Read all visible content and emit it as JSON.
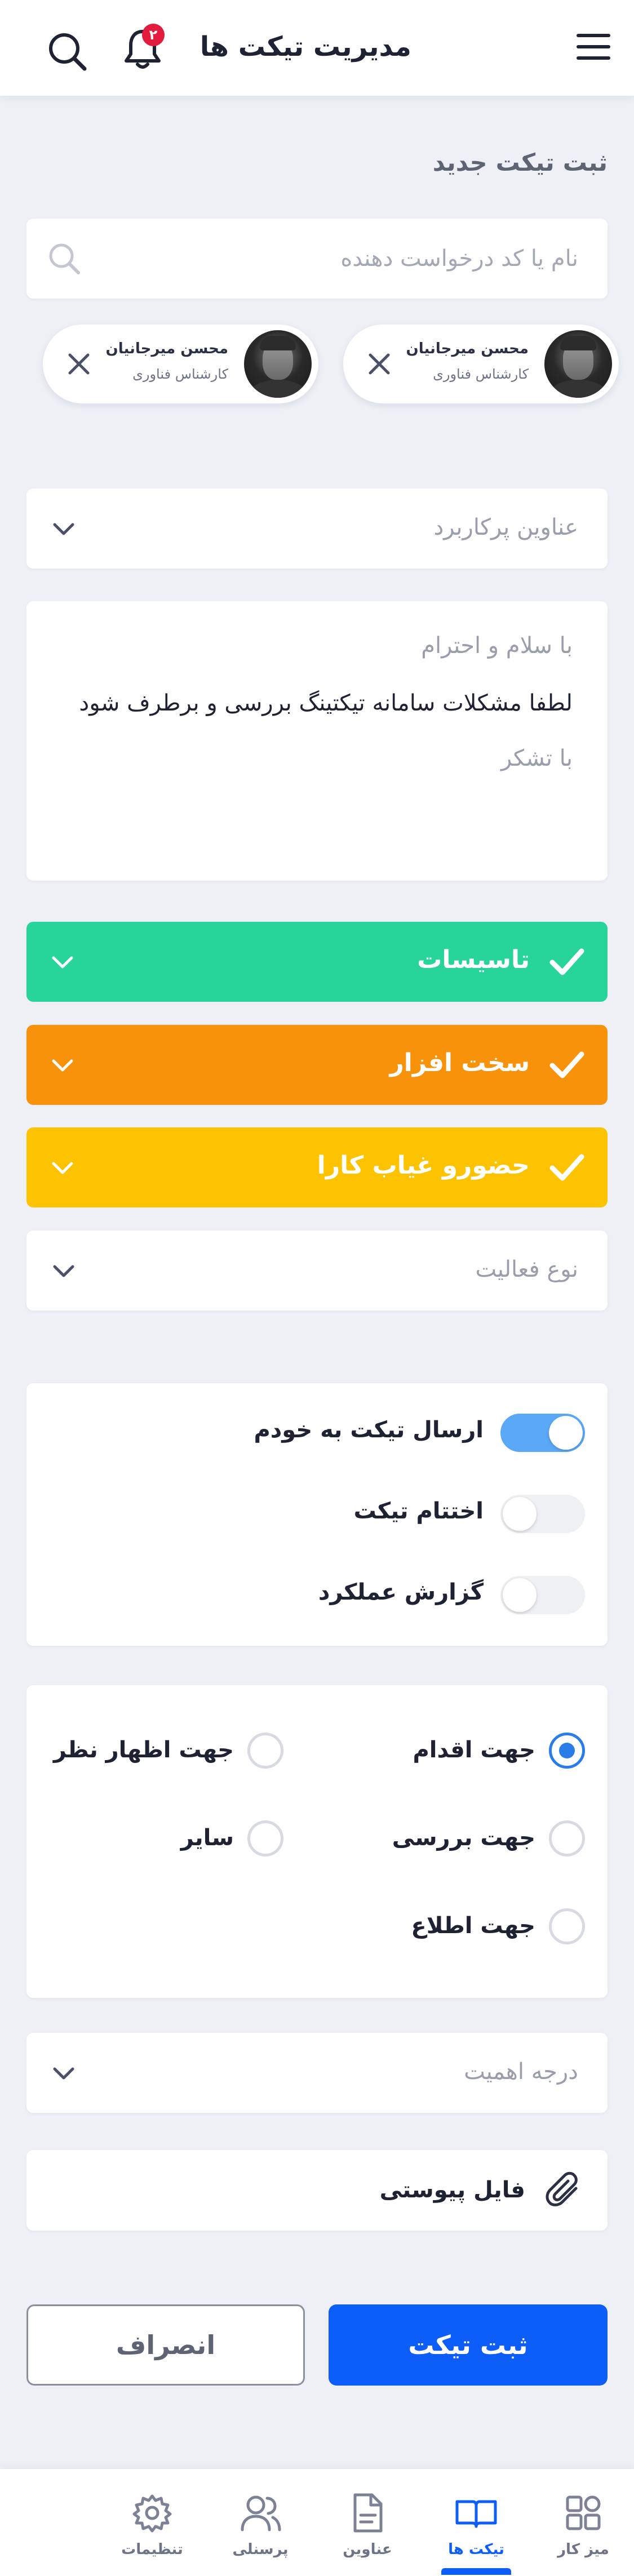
{
  "header": {
    "title": "مدیریت تیکت ها",
    "notification_count": "۲"
  },
  "page": {
    "section_title": "ثبت تیکت جدید"
  },
  "search": {
    "placeholder": "نام یا کد درخواست دهنده"
  },
  "recipients": [
    {
      "name": "محسن میرجانیان",
      "role": "کارشناس فناوری"
    },
    {
      "name": "محسن میرجانیان",
      "role": "کارشناس فناوری"
    }
  ],
  "titles_dropdown": {
    "label": "عناوین پرکاربرد"
  },
  "message": {
    "line1": "با سلام و احترام",
    "line2": "لطفا مشکلات سامانه تیکتینگ بررسی و برطرف شود",
    "line3": "با تشکر"
  },
  "categories": [
    {
      "label": "تاسیسات",
      "color": "#27d59b"
    },
    {
      "label": "سخت افزار",
      "color": "#f7920a"
    },
    {
      "label": "حضورو غیاب کارا",
      "color": "#fdc300"
    }
  ],
  "activity_dropdown": {
    "label": "نوع فعالیت"
  },
  "toggles": [
    {
      "label": "ارسال تیکت به خودم",
      "on": true
    },
    {
      "label": "اختتام تیکت",
      "on": false
    },
    {
      "label": "گزارش عملکرد",
      "on": false
    }
  ],
  "purpose_options": [
    {
      "label": "جهت اقدام",
      "selected": true
    },
    {
      "label": "جهت اظهار نظر",
      "selected": false
    },
    {
      "label": "جهت بررسی",
      "selected": false
    },
    {
      "label": "سایر",
      "selected": false
    },
    {
      "label": "جهت اطلاع",
      "selected": false
    }
  ],
  "priority_dropdown": {
    "label": "درجه اهمیت"
  },
  "attachment": {
    "label": "فایل پیوستی"
  },
  "actions": {
    "submit_label": "ثبت تیکت",
    "cancel_label": "انصراف"
  },
  "bottom_nav": [
    {
      "label": "میز کار",
      "icon": "dashboard-icon",
      "active": false
    },
    {
      "label": "تیکت ها",
      "icon": "ticket-book-icon",
      "active": true
    },
    {
      "label": "عناوین",
      "icon": "document-icon",
      "active": false
    },
    {
      "label": "پرسنلی",
      "icon": "users-icon",
      "active": false
    },
    {
      "label": "تنظیمات",
      "icon": "gear-icon",
      "active": false
    }
  ],
  "colors": {
    "accent": "#0d5ef9",
    "toggle_on": "#5aa9f7",
    "radio_selected": "#2a7de9",
    "badge": "#e31b3c"
  }
}
